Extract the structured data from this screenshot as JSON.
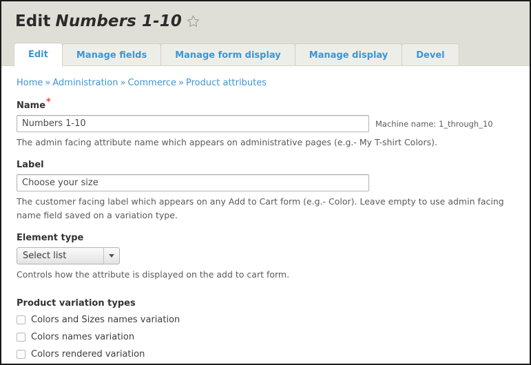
{
  "header": {
    "title_verb": "Edit",
    "title_name": "Numbers 1-10",
    "star_icon": "star-outline-icon"
  },
  "tabs": [
    {
      "label": "Edit",
      "active": true
    },
    {
      "label": "Manage fields",
      "active": false
    },
    {
      "label": "Manage form display",
      "active": false
    },
    {
      "label": "Manage display",
      "active": false
    },
    {
      "label": "Devel",
      "active": false
    }
  ],
  "breadcrumb": {
    "separator": "»",
    "items": [
      "Home",
      "Administration",
      "Commerce",
      "Product attributes"
    ]
  },
  "form": {
    "name": {
      "label": "Name",
      "required_mark": "*",
      "value": "Numbers 1-10",
      "placeholder": "",
      "machine_name": "Machine name: 1_through_10",
      "description": "The admin facing attribute name which appears on administrative pages (e.g.- My T-shirt Colors)."
    },
    "label_field": {
      "label": "Label",
      "value": "Choose your size",
      "placeholder": "",
      "description": "The customer facing label which appears on any Add to Cart form (e.g.- Color). Leave empty to use admin facing name field saved on a variation type."
    },
    "element_type": {
      "label": "Element type",
      "selected": "Select list",
      "description": "Controls how the attribute is displayed on the add to cart form."
    },
    "product_variation_types": {
      "label": "Product variation types",
      "options": [
        {
          "label": "Colors and Sizes names variation",
          "checked": false
        },
        {
          "label": "Colors names variation",
          "checked": false
        },
        {
          "label": "Colors rendered variation",
          "checked": false
        }
      ]
    }
  },
  "colors": {
    "header_bg": "#dfdfd7",
    "link_blue": "#3b96d6",
    "required_red": "#ee4444",
    "text_dark": "#333333",
    "desc_gray": "#595959"
  }
}
